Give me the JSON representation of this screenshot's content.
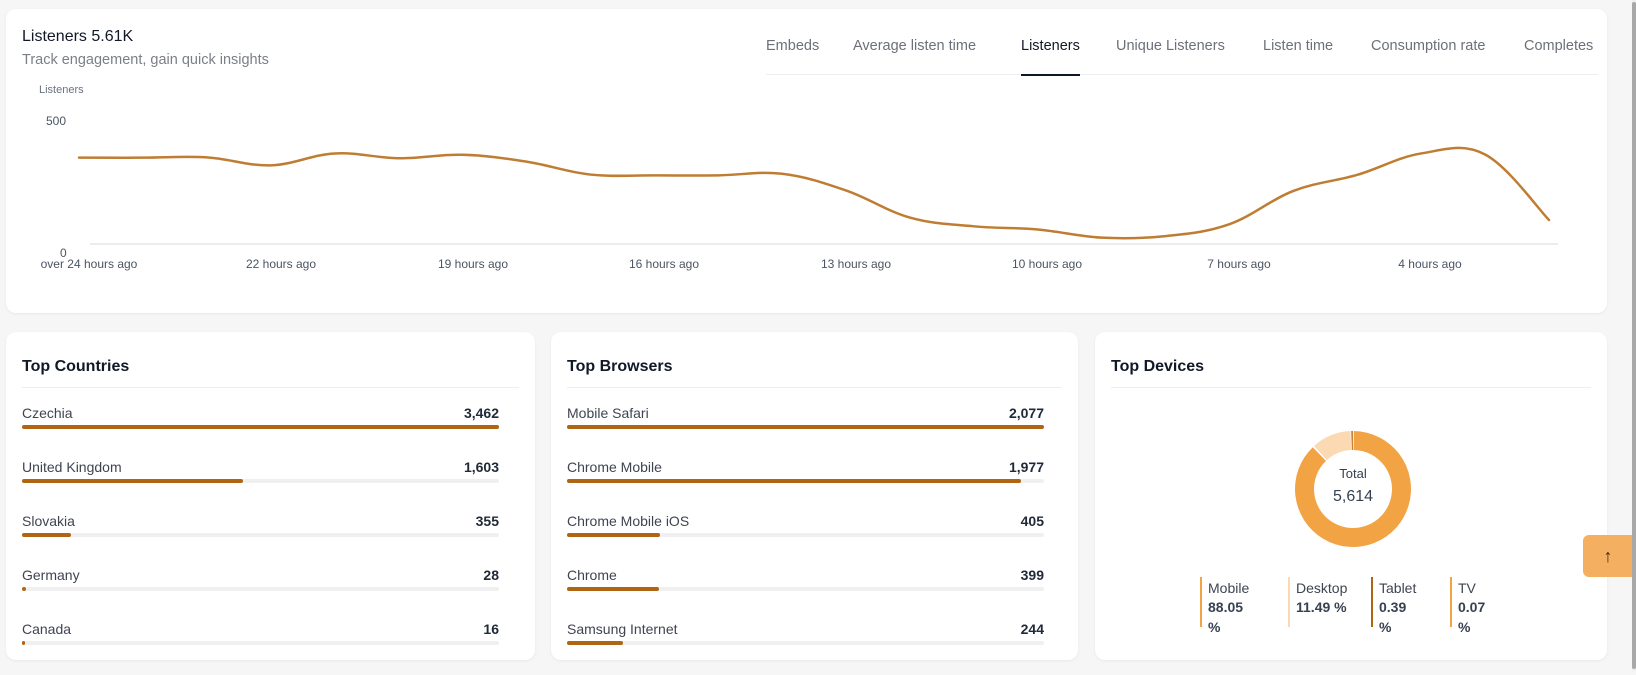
{
  "header": {
    "title": "Listeners 5.61K",
    "subtitle": "Track engagement, gain quick insights"
  },
  "tabs": [
    {
      "label": "Embeds",
      "active": false
    },
    {
      "label": "Average listen time",
      "active": false
    },
    {
      "label": "Listeners",
      "active": true
    },
    {
      "label": "Unique Listeners",
      "active": false
    },
    {
      "label": "Listen time",
      "active": false
    },
    {
      "label": "Consumption rate",
      "active": false
    },
    {
      "label": "Completes",
      "active": false
    }
  ],
  "chart_data": {
    "type": "line",
    "title": "",
    "ylabel": "Listeners",
    "xlabel": "",
    "ylim": [
      0,
      500
    ],
    "yticks": [
      0,
      500
    ],
    "xtick_labels": [
      "over 24 hours ago",
      "22 hours ago",
      "19 hours ago",
      "16 hours ago",
      "13 hours ago",
      "10 hours ago",
      "7 hours ago",
      "4 hours ago"
    ],
    "grid": false,
    "series": [
      {
        "name": "Listeners",
        "color": "#bf7d33",
        "values": [
          327,
          327,
          328,
          298,
          343,
          325,
          338,
          312,
          263,
          260,
          260,
          266,
          203,
          100,
          67,
          55,
          24,
          30,
          75,
          201,
          262,
          343,
          339,
          91
        ]
      }
    ]
  },
  "top_countries": {
    "title": "Top Countries",
    "items": [
      {
        "label": "Czechia",
        "value": "3,462",
        "count": 3462
      },
      {
        "label": "United Kingdom",
        "value": "1,603",
        "count": 1603
      },
      {
        "label": "Slovakia",
        "value": "355",
        "count": 355
      },
      {
        "label": "Germany",
        "value": "28",
        "count": 28
      },
      {
        "label": "Canada",
        "value": "16",
        "count": 16
      }
    ]
  },
  "top_browsers": {
    "title": "Top Browsers",
    "items": [
      {
        "label": "Mobile Safari",
        "value": "2,077",
        "count": 2077
      },
      {
        "label": "Chrome Mobile",
        "value": "1,977",
        "count": 1977
      },
      {
        "label": "Chrome Mobile iOS",
        "value": "405",
        "count": 405
      },
      {
        "label": "Chrome",
        "value": "399",
        "count": 399
      },
      {
        "label": "Samsung Internet",
        "value": "244",
        "count": 244
      }
    ]
  },
  "top_devices": {
    "title": "Top Devices",
    "total_label": "Total",
    "total_value": "5,614",
    "items": [
      {
        "label": "Mobile",
        "percent_text": "88.05 %",
        "percent": 88.05,
        "color": "#f2a444"
      },
      {
        "label": "Desktop",
        "percent_text": "11.49 %",
        "percent": 11.49,
        "color": "#fad9b3"
      },
      {
        "label": "Tablet",
        "percent_text": "0.39 %",
        "percent": 0.39,
        "color": "#b06513"
      },
      {
        "label": "TV",
        "percent_text": "0.07 %",
        "percent": 0.07,
        "color": "#f2a444"
      }
    ]
  },
  "colors": {
    "accent": "#b06513",
    "line": "#bf7d33",
    "button": "#f4b060"
  },
  "scroll_top_icon": "arrow-up-icon"
}
